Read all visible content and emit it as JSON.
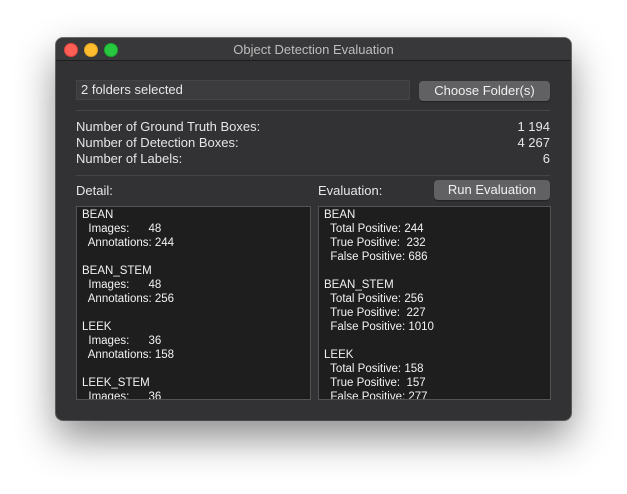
{
  "window": {
    "title": "Object Detection Evaluation"
  },
  "folder": {
    "value": "2 folders selected",
    "choose_label": "Choose Folder(s)"
  },
  "stats": [
    {
      "label": "Number of Ground Truth Boxes:",
      "value": "1 194"
    },
    {
      "label": "Number of Detection Boxes:",
      "value": "4 267"
    },
    {
      "label": "Number of Labels:",
      "value": "6"
    }
  ],
  "detail": {
    "label": "Detail:",
    "entries": [
      {
        "name": "BEAN",
        "images_line": "  Images:      48",
        "annotations_line": "  Annotations: 244"
      },
      {
        "name": "BEAN_STEM",
        "images_line": "  Images:      48",
        "annotations_line": "  Annotations: 256"
      },
      {
        "name": "LEEK",
        "images_line": "  Images:      36",
        "annotations_line": "  Annotations: 158"
      },
      {
        "name": "LEEK_STEM",
        "images_line": "  Images:      36",
        "annotations_line": ""
      }
    ]
  },
  "evaluation": {
    "label": "Evaluation:",
    "run_label": "Run Evaluation",
    "entries": [
      {
        "name": "BEAN",
        "total_line": "  Total Positive: 244",
        "true_line": "  True Positive:  232",
        "false_line": "  False Positive: 686"
      },
      {
        "name": "BEAN_STEM",
        "total_line": "  Total Positive: 256",
        "true_line": "  True Positive:  227",
        "false_line": "  False Positive: 1010"
      },
      {
        "name": "LEEK",
        "total_line": "  Total Positive: 158",
        "true_line": "  True Positive:  157",
        "false_line": "  False Positive: 277"
      }
    ]
  }
}
